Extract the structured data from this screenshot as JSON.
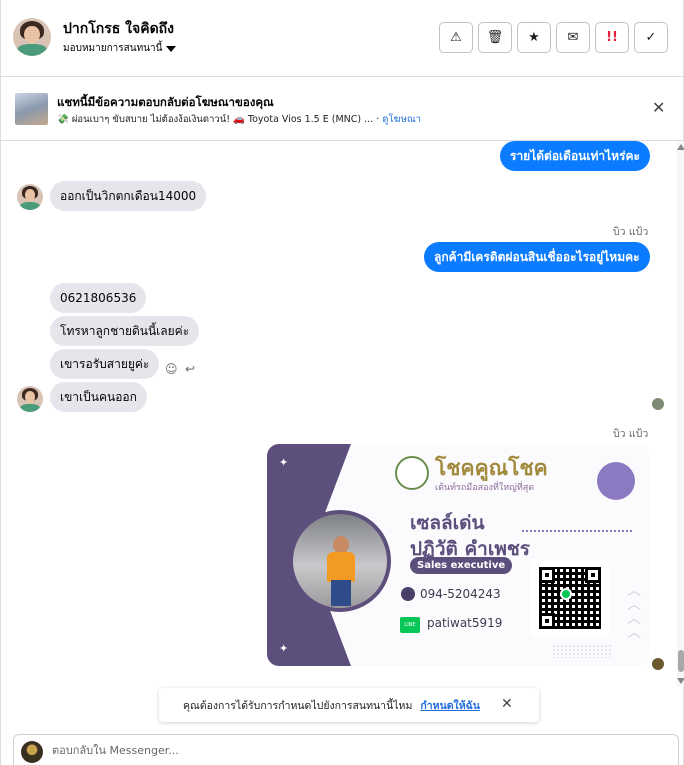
{
  "header": {
    "contact_name": "ปากโกรธ ใจคิดถึง",
    "assign_label": "มอบหมายการสนทนานี้",
    "actions": [
      {
        "name": "spam-warning-button",
        "icon": "warning-icon",
        "glyph": "⚠"
      },
      {
        "name": "delete-button",
        "icon": "trash-icon",
        "glyph": "🗑"
      },
      {
        "name": "star-button",
        "icon": "star-icon",
        "glyph": "★"
      },
      {
        "name": "mark-unread-button",
        "icon": "envelope-icon",
        "glyph": "✉"
      },
      {
        "name": "follow-up-button",
        "icon": "exclamation-icon",
        "glyph": "!!"
      },
      {
        "name": "done-button",
        "icon": "check-icon",
        "glyph": "✓"
      }
    ]
  },
  "ad": {
    "title": "แชทนี้มีข้อความตอบกลับต่อโฆษณาของคุณ",
    "subtitle": "💸 ผ่อนเบาๆ ขับสบาย ไม่ต้องง้อเงินดาวน์! 🚗 Toyota Vios 1.5 E (MNC) ...",
    "link": "ดูโฆษณา"
  },
  "messages": {
    "m1": "รายได้ต่อเดือนเท่าไหร่คะ",
    "m2": "ออกเป็นวิกตกเดือน14000",
    "seen1": "บิว แป้ว",
    "m3": "ลูกค้ามีเครดิตผ่อนสินเชื่ออะไรอยู่ไหมคะ",
    "m4": "0621806536",
    "m5": "โทรหาลูกชายดินนี้เลยค่ะ",
    "m6": "เขารอรับสายยูค่ะ",
    "m7": "เขาเป็นคนออก",
    "seen2": "บิว แป้ว"
  },
  "card": {
    "brand": "โชคคูณโชค",
    "brand_sub": "เต้นท์รถมือสองที่ใหญ่ที่สุด",
    "role": "เซลล์เด่น",
    "name": "ปฏิวัติ คำเพชร",
    "badge": "Sales executive",
    "phone": "094-5204243",
    "line_logo": "LINE",
    "line_id": "patiwat5919"
  },
  "notice": {
    "text": "คุณต้องการได้รับการกำหนดไปยังการสนทนานี้ไหม",
    "link": "กำหนดให้ฉัน"
  },
  "composer": {
    "placeholder": "ตอบกลับใน Messenger..."
  }
}
